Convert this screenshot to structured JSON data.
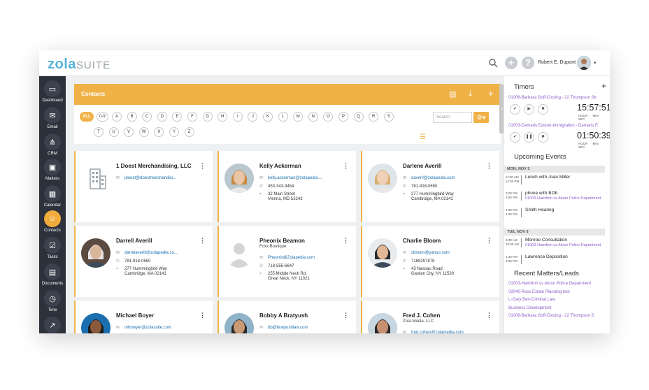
{
  "app": {
    "logo_main": "zola",
    "logo_suite": "SUITE"
  },
  "topbar": {
    "user_name": "Robert E. Dupont",
    "add_label": "+",
    "help_label": "?",
    "caret": "▾"
  },
  "sidebar": {
    "items": [
      {
        "label": "Dashboard",
        "icon": "dashboard-icon",
        "glyph": "▭"
      },
      {
        "label": "Email",
        "icon": "email-icon",
        "glyph": "✉"
      },
      {
        "label": "CRM",
        "icon": "crm-icon",
        "glyph": "⋔"
      },
      {
        "label": "Matters",
        "icon": "briefcase-icon",
        "glyph": "▣"
      },
      {
        "label": "Calendar",
        "icon": "calendar-icon",
        "glyph": "▦"
      },
      {
        "label": "Contacts",
        "icon": "contacts-icon",
        "glyph": "☺"
      },
      {
        "label": "Tasks",
        "icon": "tasks-icon",
        "glyph": "☑"
      },
      {
        "label": "Documents",
        "icon": "documents-icon",
        "glyph": "▤"
      },
      {
        "label": "Time",
        "icon": "time-icon",
        "glyph": "◷"
      },
      {
        "label": "",
        "icon": "reports-icon",
        "glyph": "↗"
      }
    ]
  },
  "contacts": {
    "title": "Contacts",
    "filters_row1": [
      "ALL",
      "0-9",
      "A",
      "B",
      "C",
      "D",
      "E",
      "F",
      "G",
      "H",
      "I",
      "J",
      "K",
      "L",
      "M",
      "N",
      "O",
      "P",
      "Q",
      "R",
      "S"
    ],
    "filters_row2": [
      "T",
      "U",
      "V",
      "W",
      "X",
      "Y",
      "Z"
    ],
    "search_placeholder": "Search",
    "cards": [
      {
        "name": "1 Doest Merchandising, LLC",
        "sub": "",
        "email": "jdoest@doestmerchandisi...",
        "phone": "",
        "addr1": "",
        "addr2": "",
        "pic": "building"
      },
      {
        "name": "Kelly Ackerman",
        "sub": "",
        "email": "kelly.ackerman@zolapedia....",
        "phone": "453-343-3454",
        "addr1": "32 Main Street",
        "addr2": "Vienna, MD 53243",
        "pic": "woman1"
      },
      {
        "name": "Darlene Averill",
        "sub": "",
        "email": "daveril@zolapedia.com",
        "phone": "781-918-0650",
        "addr1": "277 Hummingbird Way",
        "addr2": "Cambridge, MA 02141",
        "pic": "woman2"
      },
      {
        "name": "Darrell Averill",
        "sub": "",
        "email": "darrelaverill@zolapedia.co...",
        "phone": "781-918-0650",
        "addr1": "277 Hummingbird Way",
        "addr2": "Cambridge, MA 02141",
        "pic": "man1"
      },
      {
        "name": "Pheonix Beamon",
        "sub": "Foxx Boutique",
        "email": "Pheonix@Zolapedia.com",
        "phone": "718-555-6647",
        "addr1": "255 Middle Neck Rd.",
        "addr2": "Great Neck, NY 11021",
        "pic": "placeholder"
      },
      {
        "name": "Charlie Bloom",
        "sub": "",
        "email": "sbloom@yahoo.com",
        "phone": "7188297878",
        "addr1": "43 Nassau Road",
        "addr2": "Garden City, NY 11530",
        "pic": "man2"
      },
      {
        "name": "Michael Boyer",
        "sub": "",
        "email": "mbowyer@zolasuite.com",
        "phone": "",
        "addr1": "",
        "addr2": "",
        "pic": "man3"
      },
      {
        "name": "Bobby A Bratyush",
        "sub": "",
        "email": "bb@bratyushlaw.com",
        "phone": "",
        "addr1": "",
        "addr2": "",
        "pic": "man4"
      },
      {
        "name": "Fred J. Cohen",
        "sub": "Zola Media, LLC",
        "email": "fred.cohen@zolamedia.com",
        "phone": "",
        "addr1": "",
        "addr2": "",
        "pic": "man5"
      }
    ]
  },
  "timers": {
    "title": "Timers",
    "add": "+",
    "items": [
      {
        "matter": "01006-Barbara Goff-Closing - 22 Thompson Str",
        "time": "15:57:51",
        "state": "paused"
      },
      {
        "matter": "01003-Damaris Easton-Immigration - Damaris E",
        "time": "01:50:39",
        "state": "running"
      }
    ],
    "units": "HOUR MIN SEC"
  },
  "events": {
    "title": "Upcoming Events",
    "days": [
      {
        "label": "MON, NOV 5",
        "items": [
          {
            "t1": "11:00 AM",
            "t2": "12:00 PM",
            "title": "Lunch with Joan Miller",
            "link": ""
          },
          {
            "t1": "3:20 PM",
            "t2": "3:50 PM",
            "title": "phone with BOb",
            "link": "01003-Hamilton vs Akron Police Department"
          },
          {
            "t1": "3:30 PM",
            "t2": "4:00 PM",
            "title": "Smith Hearing",
            "link": ""
          }
        ]
      },
      {
        "label": "TUE, NOV 6",
        "items": [
          {
            "t1": "9:30 AM",
            "t2": "10:00 AM",
            "title": "Monroe Consultation",
            "link": "01003-Hamilton vs Akron Police Department"
          },
          {
            "t1": "1:30 PM",
            "t2": "2:00 PM",
            "title": "Lawrence Deposition",
            "link": ""
          }
        ]
      }
    ]
  },
  "recent": {
    "title": "Recent Matters/Leads",
    "items": [
      "01003-Hamilton vs Akron Police Department",
      "02040-Ross Estate Planning-test",
      "L-Gary Bell-Criminal Law",
      "Business Development",
      "01006-Barbara Goff-Closing - 22 Thompson S"
    ]
  },
  "colors": {
    "accent": "#f0b247",
    "sidebar": "#2c313b",
    "link": "#1a6fb0",
    "matter": "#8e5cc9"
  }
}
